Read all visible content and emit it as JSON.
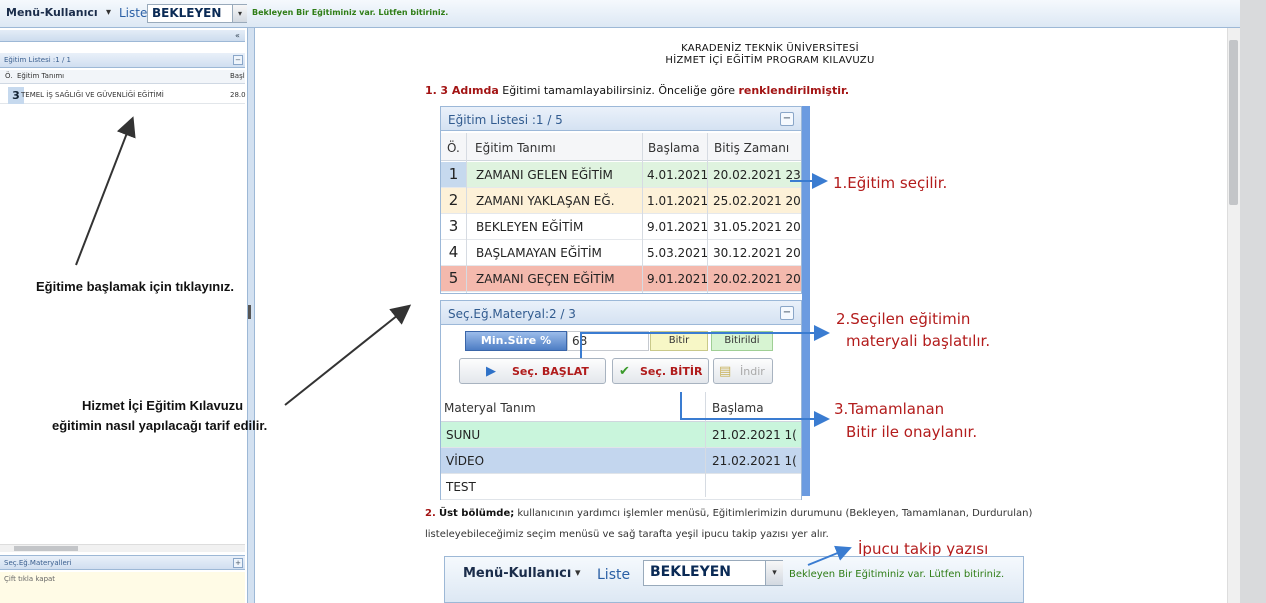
{
  "toolbar": {
    "menu_label": "Menü-Kullanıcı",
    "menu_arrow": "▾",
    "liste_label": "Liste",
    "select_value": "BEKLEYEN",
    "select_arrow": "▾",
    "tip_text": "Bekleyen Bir Eğitiminiz var. Lütfen bitiriniz."
  },
  "left_panel": {
    "collapse_icon": "«",
    "list_title": "Eğitim Listesi :1 / 1",
    "minimize_icon": "−",
    "columns": [
      "Ö.",
      "Eğitim Tanımı",
      "Başl"
    ],
    "rows": [
      {
        "num": "3",
        "name": "TEMEL İŞ SAĞLIĞI VE GÜVENLİĞİ EĞİTİMİ",
        "date": "28.0"
      }
    ],
    "footer_title": "Seç.Eğ.Materyalleri",
    "footer_expand_icon": "+",
    "footer_note": "Çift tıkla kapat"
  },
  "annotations": {
    "start_note": "Eğitime başlamak için tıklayınız.",
    "guide_note_line1": "Hizmet İçi Eğitim Kılavuzu",
    "guide_note_line2": "eğitimin nasıl yapılacağı tarif edilir."
  },
  "guide": {
    "title_line1": "KARADENİZ TEKNİK ÜNİVERSİTESİ",
    "title_line2": "HİZMET İÇİ EĞİTİM PROGRAM KILAVUZU",
    "step1_prefix": "1.",
    "step1_bold": "3 Adımda",
    "step1_text": " Eğitimi tamamlayabilirsiniz. Önceliğe göre ",
    "step1_emph": "renklendirilmiştir.",
    "list": {
      "title": "Eğitim Listesi :1 / 5",
      "minimize_icon": "−",
      "columns": [
        "Ö.",
        "Eğitim Tanımı",
        "Başlama",
        "Bitiş Zamanı"
      ],
      "rows": [
        {
          "num": "1",
          "name": "ZAMANI GELEN EĞİTİM",
          "start": "4.01.2021",
          "end": "20.02.2021 23",
          "color": "#dff3df",
          "num_color": "#c6d9ee"
        },
        {
          "num": "2",
          "name": "ZAMANI YAKLAŞAN EĞ.",
          "start": "1.01.2021",
          "end": "25.02.2021 20:",
          "color": "#fdf1d8",
          "num_color": "#fdf1d8"
        },
        {
          "num": "3",
          "name": "BEKLEYEN EĞİTİM",
          "start": "9.01.2021",
          "end": "31.05.2021 20:",
          "color": "#ffffff",
          "num_color": "#ffffff"
        },
        {
          "num": "4",
          "name": "BAŞLAMAYAN EĞİTİM",
          "start": "5.03.2021",
          "end": "30.12.2021 20:",
          "color": "#ffffff",
          "num_color": "#ffffff"
        },
        {
          "num": "5",
          "name": "ZAMANI GEÇEN EĞİTİM",
          "start": "9.01.2021",
          "end": "20.02.2021 20:",
          "color": "#f4b9ad",
          "num_color": "#f4b9ad"
        }
      ]
    },
    "callout1": "1.Eğitim seçilir.",
    "material": {
      "title": "Seç.Eğ.Materyal:2 / 3",
      "minimize_icon": "−",
      "min_label": "Min.Süre %",
      "min_value": "68",
      "bitir_label": "Bitir",
      "bitirildi_label": "Bitirildi",
      "start_button": "Seç. BAŞLAT",
      "finish_button": "Seç. BİTİR",
      "download_button": "İndir",
      "columns": [
        "Materyal Tanım",
        "Başlama"
      ],
      "rows": [
        {
          "name": "SUNU",
          "start": "21.02.2021 1(",
          "color": "#c9f5dc"
        },
        {
          "name": "VİDEO",
          "start": "21.02.2021 1(",
          "color": "#c3d6ee"
        },
        {
          "name": "TEST",
          "start": "",
          "color": "#ffffff"
        }
      ]
    },
    "callout2_line1": "2.Seçilen eğitimin",
    "callout2_line2": "materyali başlatılır.",
    "callout3_line1": "3.Tamamlanan",
    "callout3_line2": "Bitir ile onaylanır.",
    "step2_prefix": "2.",
    "step2_bold": "Üst bölümde;",
    "step2_text": " kullanıcının yardımcı işlemler menüsü, Eğitimlerimizin durumunu (Bekleyen, Tamamlanan, Durdurulan) listeleyebileceğimiz seçim menüsü ve sağ tarafta yeşil ipucu takip yazısı yer alır.",
    "ipucu_label": "İpucu takip yazısı",
    "example_toolbar": {
      "menu_label": "Menü-Kullanıcı",
      "menu_arrow": "▾",
      "liste_label": "Liste",
      "select_value": "BEKLEYEN",
      "select_arrow": "▾",
      "tip_text": "Bekleyen Bir Eğitiminiz var. Lütfen bitiriniz."
    }
  },
  "colors": {
    "callout_red": "#b31c1c",
    "arrow_blue": "#3a7cd1",
    "tip_green": "#2f7d16",
    "header_blue": "#315b8f"
  }
}
